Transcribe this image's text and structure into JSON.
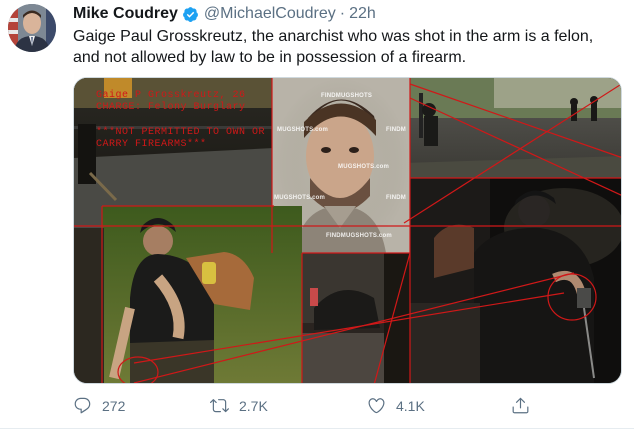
{
  "tweet": {
    "display_name": "Mike Coudrey",
    "handle": "@MichaelCoudrey",
    "separator": "·",
    "time": "22h",
    "text": "Gaige Paul Grosskreutz, the anarchist who was shot in the arm is a felon, and not allowed by law to be in possession of a firearm."
  },
  "media": {
    "overlay_line1": "Gaige P Grosskreutz, 26",
    "overlay_line2": "CHARGE: Felony Burglary",
    "overlay_line3": "***NOT PERMITTED TO OWN OR",
    "overlay_line4": "CARRY FIREARMS***",
    "watermark": "FINDMUGSHOTS",
    "watermark_com": "FINDMUGSHOTS.com",
    "watermark_short": "FINDM",
    "watermark_mid": "MUGSHOTS.com",
    "annotation_color": "#d01818"
  },
  "actions": {
    "reply_count": "272",
    "retweet_count": "2.7K",
    "like_count": "4.1K"
  },
  "icons": {
    "reply": "reply-icon",
    "retweet": "retweet-icon",
    "like": "like-icon",
    "share": "share-icon",
    "verified": "verified-badge-icon"
  }
}
